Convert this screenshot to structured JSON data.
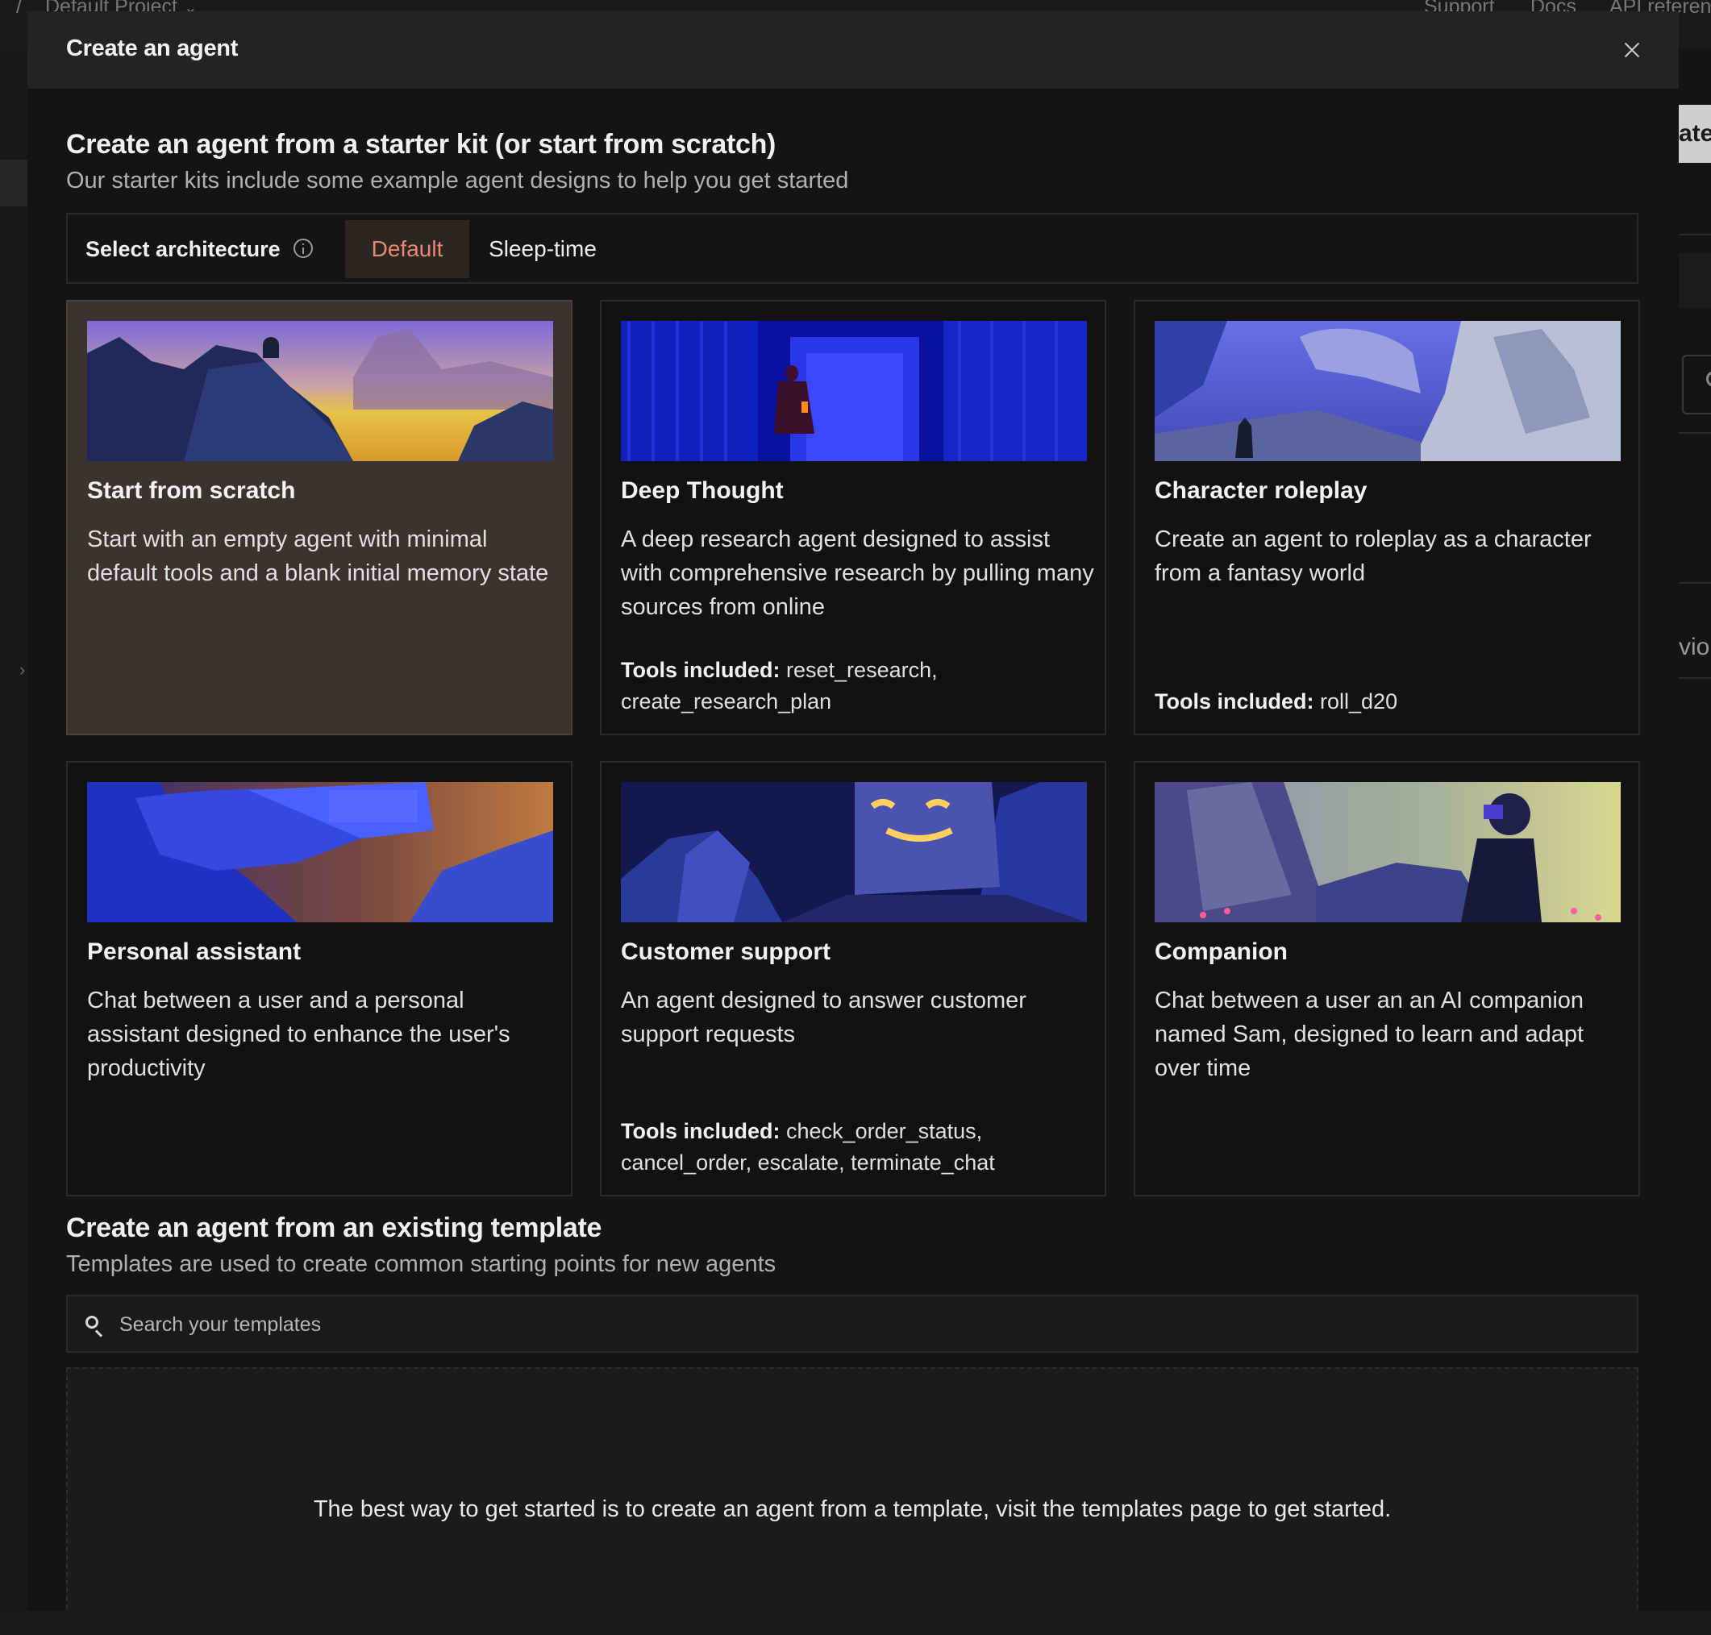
{
  "background": {
    "breadcrumb_sep": "/",
    "project_name": "Default Project",
    "nav_support": "Support",
    "nav_docs": "Docs",
    "nav_api": "API reference",
    "right_button_partial": "ate",
    "right_text_partial": "vio"
  },
  "modal": {
    "title": "Create an agent",
    "starter": {
      "title": "Create an agent from a starter kit (or start from scratch)",
      "subtitle": "Our starter kits include some example agent designs to help you get started",
      "architecture_label": "Select architecture",
      "tabs": [
        {
          "label": "Default",
          "selected": true
        },
        {
          "label": "Sleep-time",
          "selected": false
        }
      ],
      "tools_prefix": "Tools included:",
      "cards": [
        {
          "title": "Start from scratch",
          "description": "Start with an empty agent with minimal default tools and a blank initial memory state",
          "tools": "",
          "selected": true
        },
        {
          "title": "Deep Thought",
          "description": "A deep research agent designed to assist with comprehensive research by pulling many sources from online",
          "tools": "reset_research, create_research_plan",
          "selected": false
        },
        {
          "title": "Character roleplay",
          "description": "Create an agent to roleplay as a character from a fantasy world",
          "tools": "roll_d20",
          "selected": false
        },
        {
          "title": "Personal assistant",
          "description": "Chat between a user and a personal assistant designed to enhance the user's productivity",
          "tools": "",
          "selected": false
        },
        {
          "title": "Customer support",
          "description": "An agent designed to answer customer support requests",
          "tools": "check_order_status, cancel_order, escalate, terminate_chat",
          "selected": false
        },
        {
          "title": "Companion",
          "description": "Chat between a user an an AI companion named Sam, designed to learn and adapt over time",
          "tools": "",
          "selected": false
        }
      ]
    },
    "templates": {
      "title": "Create an agent from an existing template",
      "subtitle": "Templates are used to create common starting points for new agents",
      "search_placeholder": "Search your templates",
      "empty_message": "The best way to get started is to create an agent from a template, visit the templates page to get started."
    }
  },
  "colors": {
    "accent": "#e58a6e",
    "selected_card": "#3a3331",
    "background": "#141414"
  }
}
